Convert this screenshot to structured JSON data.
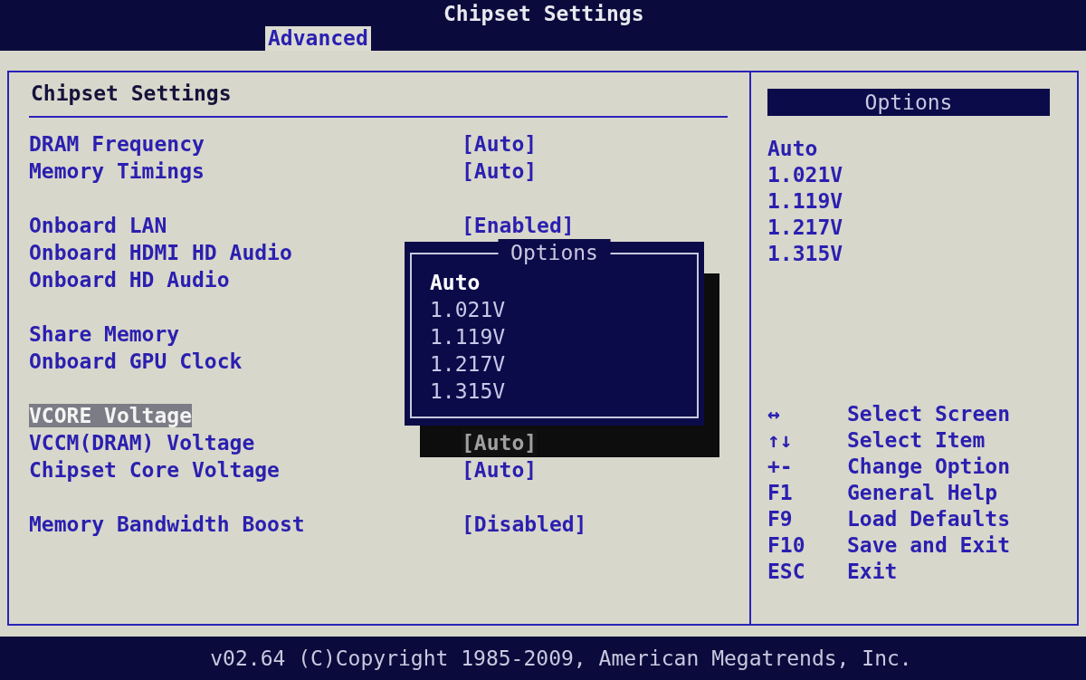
{
  "header": {
    "title": "Chipset Settings",
    "tabs": [
      {
        "label": "Advanced",
        "selected": true
      }
    ]
  },
  "settings": {
    "title": "Chipset Settings",
    "groups": [
      [
        {
          "label": "DRAM Frequency",
          "value": "[Auto]",
          "selected": false,
          "shaded": false
        },
        {
          "label": "Memory Timings",
          "value": "[Auto]",
          "selected": false,
          "shaded": false
        }
      ],
      [
        {
          "label": "Onboard LAN",
          "value": "[Enabled]",
          "selected": false,
          "shaded": false
        },
        {
          "label": "Onboard HDMI HD Audio",
          "selected": false
        },
        {
          "label": "Onboard HD Audio",
          "selected": false
        }
      ],
      [
        {
          "label": "Share Memory",
          "selected": false
        },
        {
          "label": "Onboard GPU Clock",
          "selected": false
        }
      ],
      [
        {
          "label": "VCORE Voltage",
          "selected": true
        },
        {
          "label": "VCCM(DRAM) Voltage",
          "value": "[Auto]",
          "selected": false,
          "shaded": true
        },
        {
          "label": "Chipset Core Voltage",
          "value": "[Auto]",
          "selected": false,
          "shaded": false
        }
      ],
      [
        {
          "label": "Memory Bandwidth Boost",
          "value": "[Disabled]",
          "selected": false,
          "shaded": false
        }
      ]
    ]
  },
  "popup": {
    "title": "Options",
    "items": [
      {
        "label": "Auto",
        "selected": true
      },
      {
        "label": "1.021V",
        "selected": false
      },
      {
        "label": "1.119V",
        "selected": false
      },
      {
        "label": "1.217V",
        "selected": false
      },
      {
        "label": "1.315V",
        "selected": false
      }
    ]
  },
  "help": {
    "title": "Options",
    "options": [
      "Auto",
      "1.021V",
      "1.119V",
      "1.217V",
      "1.315V"
    ],
    "keys": [
      {
        "key": "↔",
        "action": "Select Screen"
      },
      {
        "key": "↑↓",
        "action": "Select Item"
      },
      {
        "key": "+-",
        "action": "Change Option"
      },
      {
        "key": "F1",
        "action": "General Help"
      },
      {
        "key": "F9",
        "action": "Load Defaults"
      },
      {
        "key": "F10",
        "action": "Save and Exit"
      },
      {
        "key": "ESC",
        "action": "Exit"
      }
    ]
  },
  "footer": "v02.64 (C)Copyright 1985-2009, American Megatrends, Inc."
}
